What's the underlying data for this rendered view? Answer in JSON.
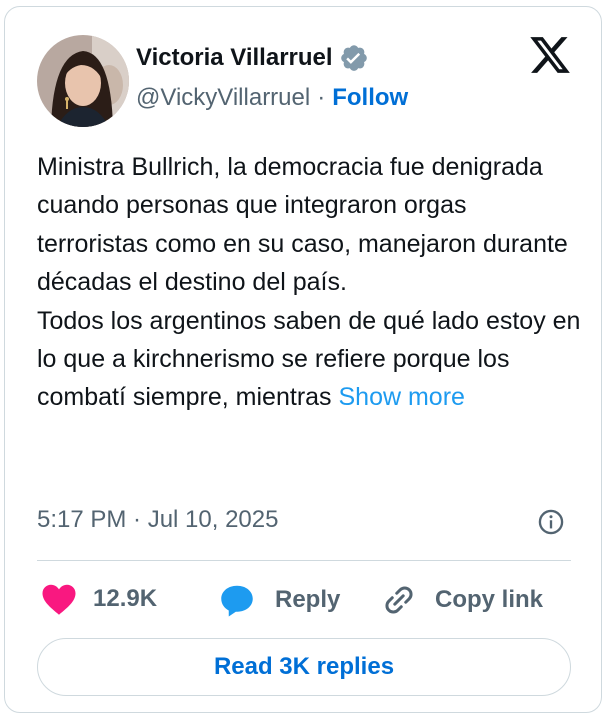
{
  "author": {
    "name": "Victoria Villarruel",
    "handle": "@VickyVillarruel",
    "separator": "·",
    "follow_label": "Follow",
    "verified_icon": "verified-badge-icon"
  },
  "tweet": {
    "paragraph1": "Ministra Bullrich, la democracia fue denigrada cuando personas que integraron orgas terroristas como en su caso, manejaron durante décadas el destino del país.",
    "paragraph2": "Todos los argentinos saben de qué lado estoy en lo que a kirchnerismo se refiere porque los combatí siempre, mientras",
    "show_more": "Show more",
    "timestamp": "5:17 PM · Jul 10, 2025"
  },
  "actions": {
    "likes": "12.9K",
    "reply_label": "Reply",
    "copy_label": "Copy link"
  },
  "read_replies_label": "Read 3K replies",
  "colors": {
    "like": "#f91880",
    "reply": "#1d9bf0",
    "link": "#006fd6",
    "verified": "#829aab"
  }
}
